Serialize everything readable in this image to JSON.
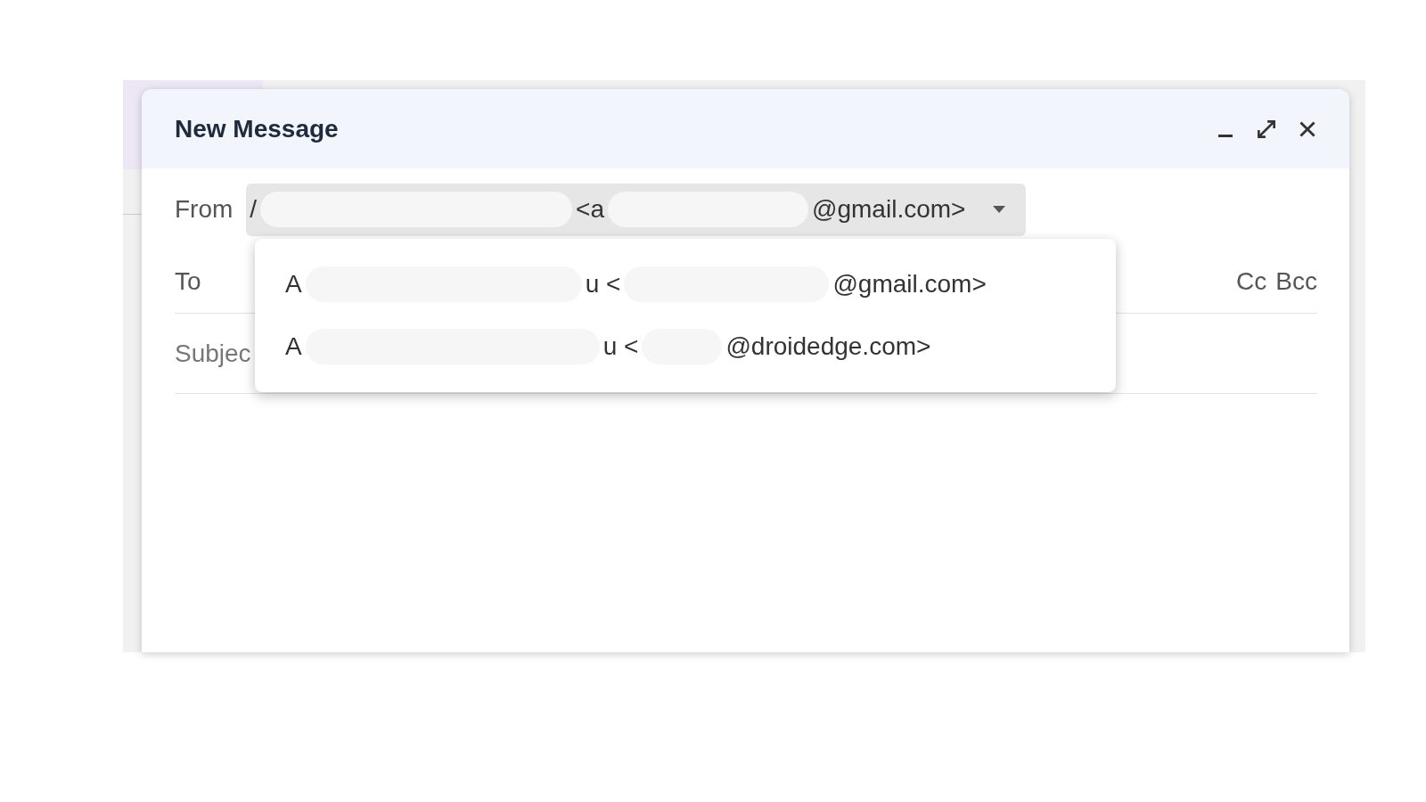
{
  "compose": {
    "title": "New Message",
    "window_controls": [
      {
        "kind": "minimize"
      },
      {
        "kind": "expand"
      },
      {
        "kind": "close"
      }
    ],
    "from": {
      "label": "From",
      "segments": [
        {
          "kind": "text",
          "text": "/"
        },
        {
          "kind": "redacted"
        },
        {
          "kind": "text",
          "text": "<a"
        },
        {
          "kind": "redacted"
        },
        {
          "kind": "text",
          "text": "@gmail.com>"
        }
      ],
      "expanded": true
    },
    "to": {
      "label": "To",
      "links": [
        "Cc",
        "Bcc"
      ]
    },
    "subject": {
      "placeholder": "Subjec"
    },
    "from_options": [
      {
        "segments": [
          {
            "kind": "text",
            "text": "A"
          },
          {
            "kind": "redacted"
          },
          {
            "kind": "text",
            "text": "u <"
          },
          {
            "kind": "redacted"
          },
          {
            "kind": "text",
            "text": "@gmail.com>"
          }
        ]
      },
      {
        "segments": [
          {
            "kind": "text",
            "text": "A"
          },
          {
            "kind": "redacted"
          },
          {
            "kind": "text",
            "text": "u <"
          },
          {
            "kind": "redacted"
          },
          {
            "kind": "text",
            "text": "@droidedge.com>"
          }
        ]
      }
    ]
  }
}
